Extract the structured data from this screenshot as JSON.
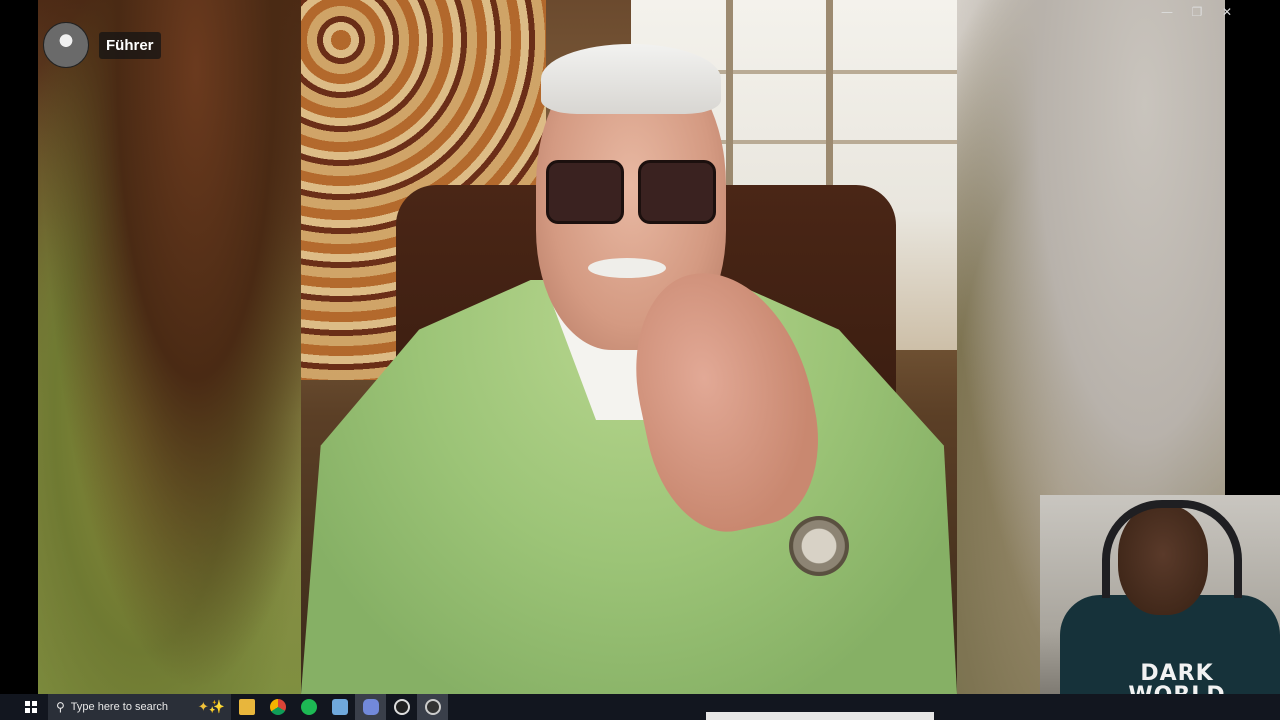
{
  "call": {
    "caller_name": "Führer"
  },
  "window_controls": {
    "minimize": "—",
    "restore": "❐",
    "close": "✕"
  },
  "webcam": {
    "shirt_text_line1": "DARK",
    "shirt_text_line2": "WORLD"
  },
  "taskbar": {
    "search_placeholder": "Type here to search",
    "search_icon_glyph": "⚲",
    "sparkle_glyph": "✦✨",
    "pinned_apps": [
      "file-explorer",
      "chrome",
      "spotify",
      "notepad",
      "discord",
      "obs",
      "media-player"
    ]
  }
}
